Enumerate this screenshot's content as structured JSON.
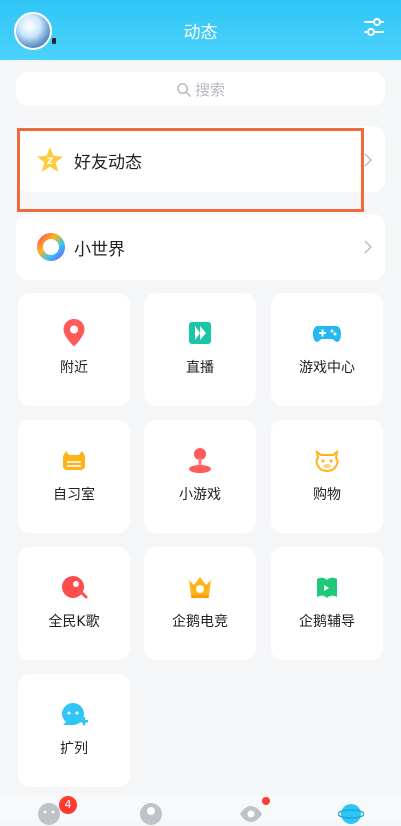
{
  "header": {
    "title": "动态"
  },
  "search": {
    "placeholder": "搜索"
  },
  "rows": [
    {
      "label": "好友动态",
      "icon": "qzone-star-icon"
    },
    {
      "label": "小世界",
      "icon": "small-world-ring-icon"
    }
  ],
  "grid": [
    {
      "label": "附近",
      "icon": "location-pin-icon",
      "color": "#ff5a5a"
    },
    {
      "label": "直播",
      "icon": "live-play-icon",
      "color": "#19c7a6"
    },
    {
      "label": "游戏中心",
      "icon": "gamepad-icon",
      "color": "#25b9f2"
    },
    {
      "label": "自习室",
      "icon": "study-room-cat-icon",
      "color": "#ffb21a"
    },
    {
      "label": "小游戏",
      "icon": "joystick-icon",
      "color": "#ff5a5a"
    },
    {
      "label": "购物",
      "icon": "shopping-cow-icon",
      "color": "#ffb21a"
    },
    {
      "label": "全民K歌",
      "icon": "karaoke-icon",
      "color": "#ff4d4d"
    },
    {
      "label": "企鹅电竞",
      "icon": "esports-crown-icon",
      "color": "#ffb21a"
    },
    {
      "label": "企鹅辅导",
      "icon": "tutoring-book-icon",
      "color": "#1fc97a"
    },
    {
      "label": "扩列",
      "icon": "expand-friends-icon",
      "color": "#2fc6f5"
    }
  ],
  "bottom_nav": {
    "messages_badge": "4"
  }
}
